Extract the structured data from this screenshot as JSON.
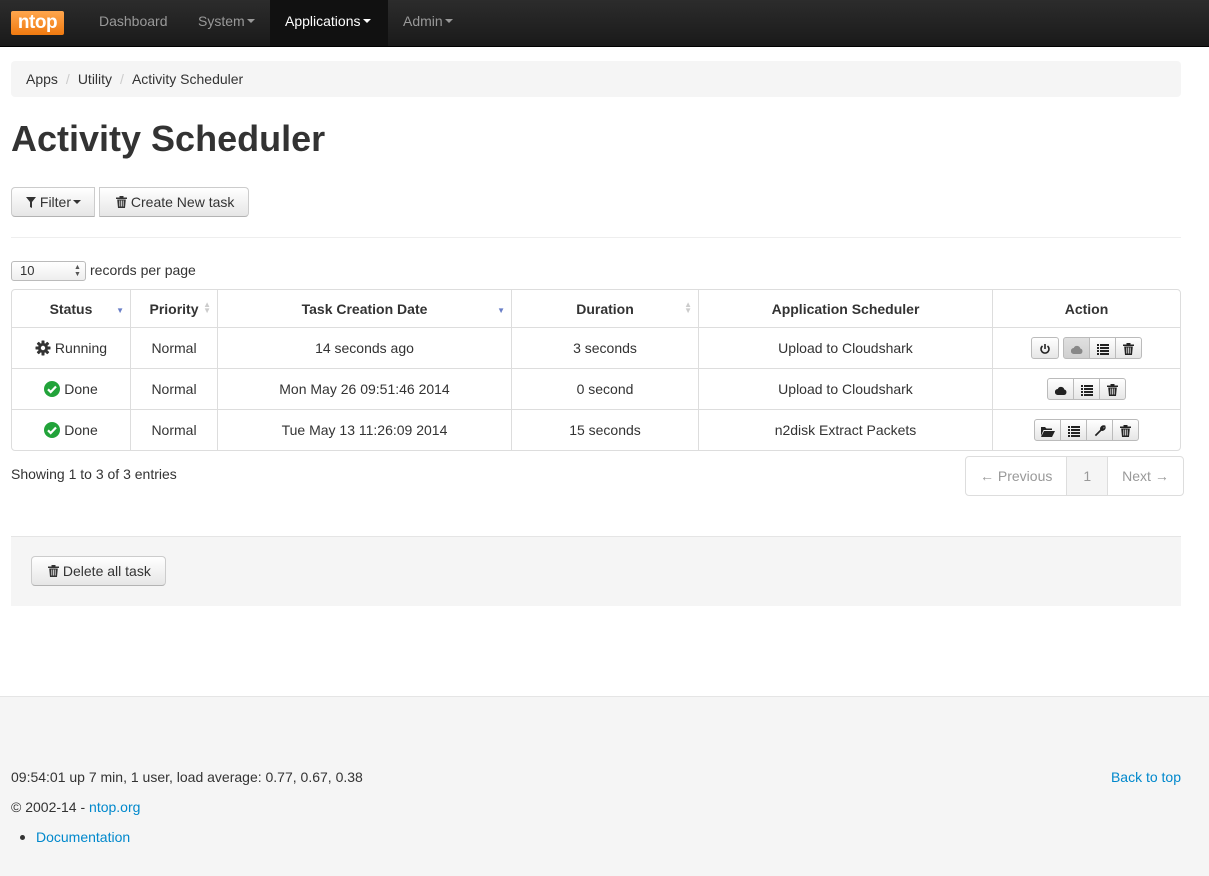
{
  "navbar": {
    "logo": "ntop",
    "items": [
      {
        "label": "Dashboard",
        "dropdown": false,
        "active": false
      },
      {
        "label": "System",
        "dropdown": true,
        "active": false
      },
      {
        "label": "Applications",
        "dropdown": true,
        "active": true
      },
      {
        "label": "Admin",
        "dropdown": true,
        "active": false
      }
    ]
  },
  "breadcrumb": [
    "Apps",
    "Utility",
    "Activity Scheduler"
  ],
  "page_title": "Activity Scheduler",
  "toolbar": {
    "filter_label": "Filter",
    "create_label": "Create New task"
  },
  "records": {
    "value": "10",
    "label": "records per page"
  },
  "table": {
    "columns": [
      "Status",
      "Priority",
      "Task Creation Date",
      "Duration",
      "Application Scheduler",
      "Action"
    ],
    "rows": [
      {
        "status": "Running",
        "status_icon": "gear-icon",
        "priority": "Normal",
        "created": "14 seconds ago",
        "duration": "3 seconds",
        "app": "Upload to Cloudshark",
        "actions": [
          "power-icon",
          "cloud-icon",
          "list-icon",
          "trash-icon"
        ]
      },
      {
        "status": "Done",
        "status_icon": "check-circle-icon",
        "priority": "Normal",
        "created": "Mon May 26 09:51:46 2014",
        "duration": "0 second",
        "app": "Upload to Cloudshark",
        "actions": [
          "cloud-icon",
          "list-icon",
          "trash-icon"
        ]
      },
      {
        "status": "Done",
        "status_icon": "check-circle-icon",
        "priority": "Normal",
        "created": "Tue May 13 11:26:09 2014",
        "duration": "15 seconds",
        "app": "n2disk Extract Packets",
        "actions": [
          "folder-open-icon",
          "list-icon",
          "wrench-icon",
          "trash-icon"
        ]
      }
    ]
  },
  "showing": "Showing 1 to 3 of 3 entries",
  "pagination": {
    "prev": "← Previous",
    "page": "1",
    "next": "Next →"
  },
  "delete_all_label": "Delete all task",
  "footer": {
    "uptime": "09:54:01 up 7 min, 1 user, load average: 0.77, 0.67, 0.38",
    "back_to_top": "Back to top",
    "copyright_prefix": "© 2002-14 - ",
    "copyright_link": "ntop.org",
    "documentation": "Documentation"
  },
  "colors": {
    "accent_link": "#0088cc",
    "success": "#22a33a",
    "logo_orange": "#f7931e"
  }
}
